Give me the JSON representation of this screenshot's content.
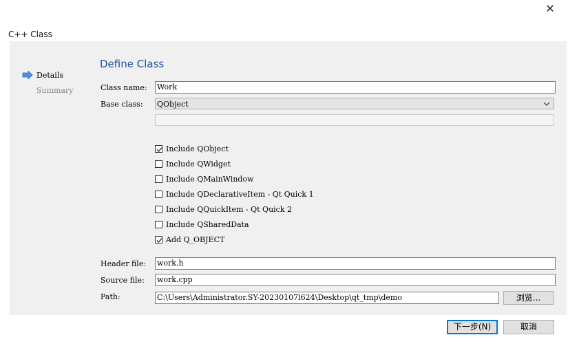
{
  "window": {
    "title": "C++ Class",
    "close_glyph": "✕"
  },
  "steps": [
    {
      "label": "Details",
      "current": true
    },
    {
      "label": "Summary",
      "current": false
    }
  ],
  "form": {
    "section_title": "Define Class",
    "class_name_label": "Class name:",
    "class_name_value": "Work",
    "base_class_label": "Base class:",
    "base_class_value": "QObject",
    "checkboxes": [
      {
        "label": "Include QObject",
        "checked": true
      },
      {
        "label": "Include QWidget",
        "checked": false
      },
      {
        "label": "Include QMainWindow",
        "checked": false
      },
      {
        "label": "Include QDeclarativeItem - Qt Quick 1",
        "checked": false
      },
      {
        "label": "Include QQuickItem - Qt Quick 2",
        "checked": false
      },
      {
        "label": "Include QSharedData",
        "checked": false
      },
      {
        "label": "Add Q_OBJECT",
        "checked": true
      }
    ],
    "header_file_label": "Header file:",
    "header_file_value": "work.h",
    "source_file_label": "Source file:",
    "source_file_value": "work.cpp",
    "path_label": "Path:",
    "path_value": "C:\\Users\\Administrator.SY-20230107l624\\Desktop\\qt_tmp\\demo",
    "browse_label": "浏览..."
  },
  "footer": {
    "next_label": "下一步(N)",
    "cancel_label": "取消"
  },
  "colors": {
    "accent": "#0078d7",
    "title_blue": "#1f4f9f",
    "panel_bg": "#f0f0f0"
  },
  "icons": {
    "step_arrow": "arrow-right-icon",
    "close": "close-icon",
    "dropdown": "chevron-down-icon",
    "check": "check-icon"
  }
}
